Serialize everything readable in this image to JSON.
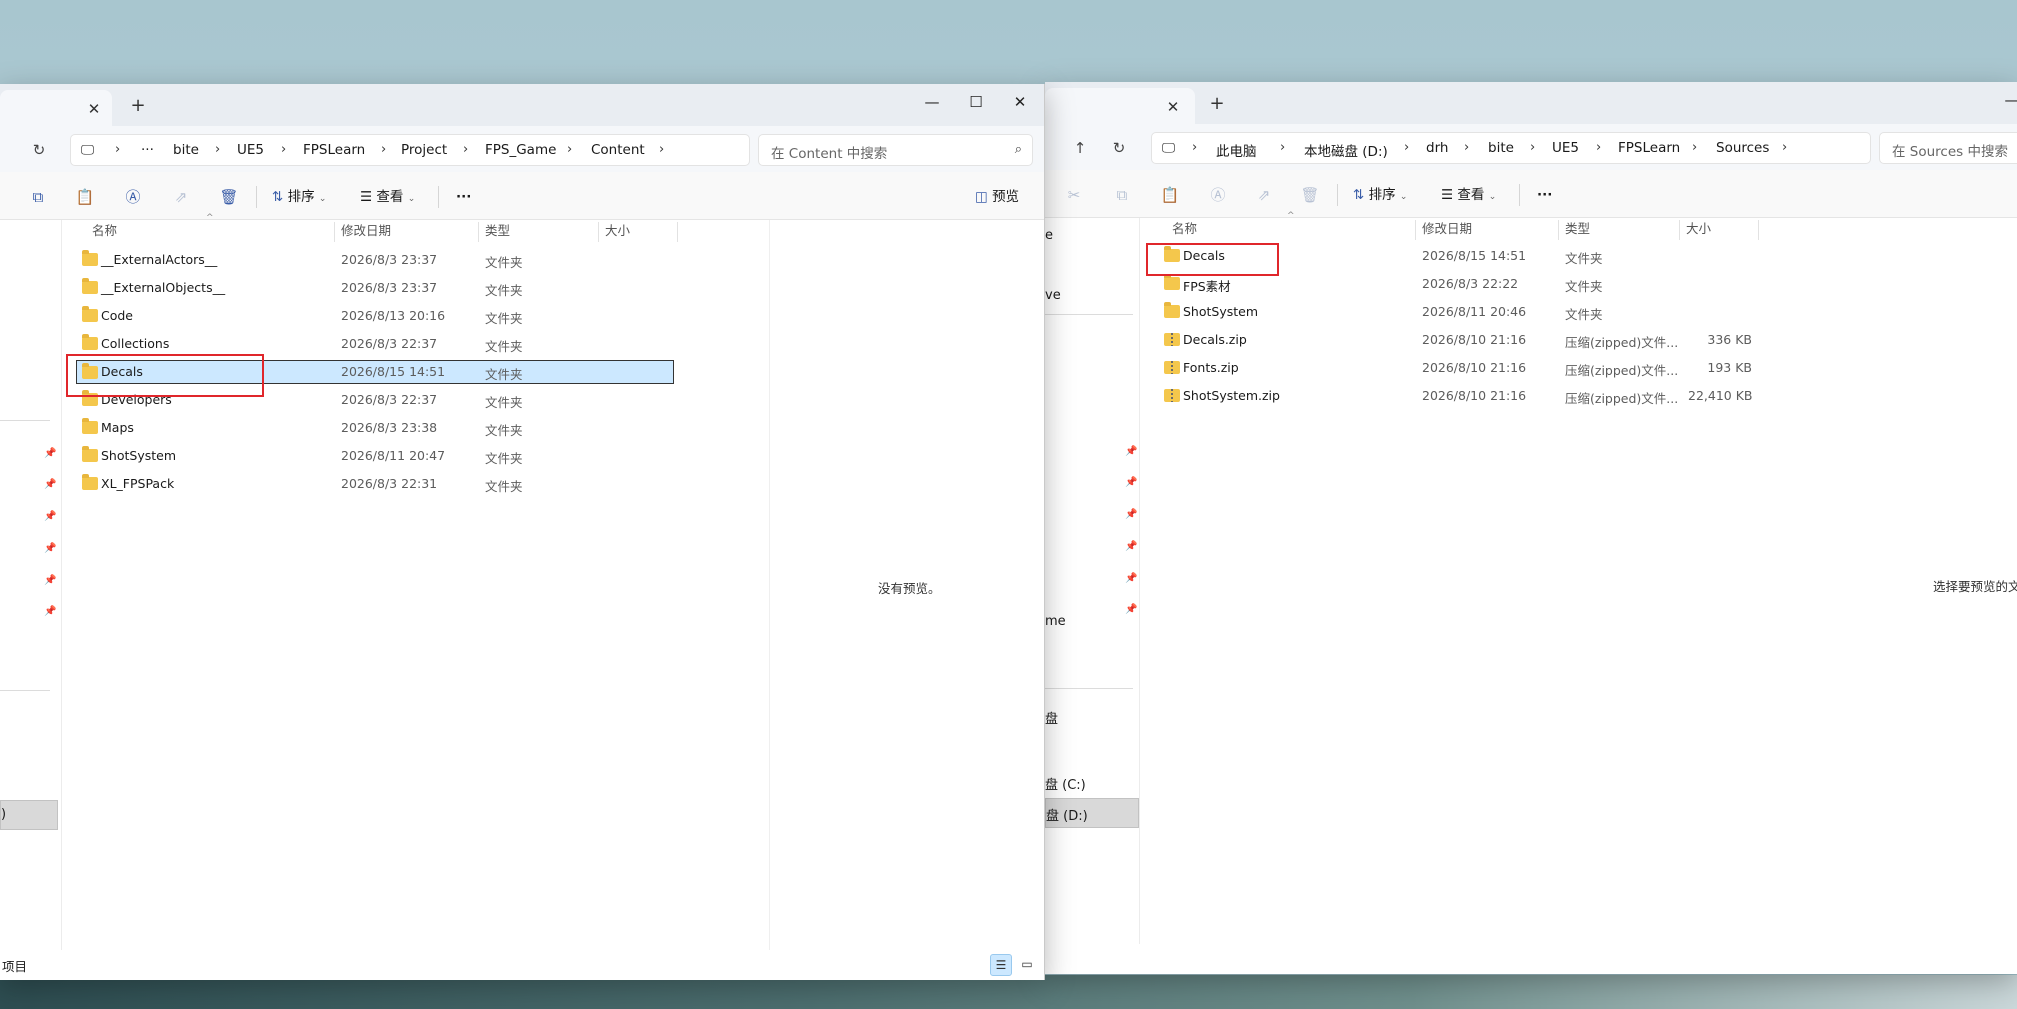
{
  "left_window": {
    "breadcrumb": [
      "···",
      "bite",
      "UE5",
      "FPSLearn",
      "Project",
      "FPS_Game",
      "Content"
    ],
    "search_placeholder": "在 Content 中搜索",
    "toolbar": {
      "sort_label": "排序",
      "view_label": "查看",
      "more_label": "···",
      "preview_label": "预览"
    },
    "columns": {
      "name": "名称",
      "date": "修改日期",
      "type": "类型",
      "size": "大小"
    },
    "rows": [
      {
        "name": "__ExternalActors__",
        "date": "2026/8/3 23:37",
        "type": "文件夹",
        "size": ""
      },
      {
        "name": "__ExternalObjects__",
        "date": "2026/8/3 23:37",
        "type": "文件夹",
        "size": ""
      },
      {
        "name": "Code",
        "date": "2026/8/13 20:16",
        "type": "文件夹",
        "size": ""
      },
      {
        "name": "Collections",
        "date": "2026/8/3 22:37",
        "type": "文件夹",
        "size": ""
      },
      {
        "name": "Decals",
        "date": "2026/8/15 14:51",
        "type": "文件夹",
        "size": ""
      },
      {
        "name": "Developers",
        "date": "2026/8/3 22:37",
        "type": "文件夹",
        "size": ""
      },
      {
        "name": "Maps",
        "date": "2026/8/3 23:38",
        "type": "文件夹",
        "size": ""
      },
      {
        "name": "ShotSystem",
        "date": "2026/8/11 20:47",
        "type": "文件夹",
        "size": ""
      },
      {
        "name": "XL_FPSPack",
        "date": "2026/8/3 22:31",
        "type": "文件夹",
        "size": ""
      }
    ],
    "selected_row": "Decals",
    "nav_items": [
      ")"
    ],
    "preview_text": "没有预览。",
    "status_text": "项目"
  },
  "right_window": {
    "breadcrumb": [
      "此电脑",
      "本地磁盘 (D:)",
      "drh",
      "bite",
      "UE5",
      "FPSLearn",
      "Sources"
    ],
    "search_placeholder": "在 Sources 中搜索",
    "toolbar": {
      "sort_label": "排序",
      "view_label": "查看",
      "more_label": "···"
    },
    "columns": {
      "name": "名称",
      "date": "修改日期",
      "type": "类型",
      "size": "大小"
    },
    "rows": [
      {
        "name": "Decals",
        "date": "2026/8/15 14:51",
        "type": "文件夹",
        "size": "",
        "kind": "folder"
      },
      {
        "name": "FPS素材",
        "date": "2026/8/3 22:22",
        "type": "文件夹",
        "size": "",
        "kind": "folder"
      },
      {
        "name": "ShotSystem",
        "date": "2026/8/11 20:46",
        "type": "文件夹",
        "size": "",
        "kind": "folder"
      },
      {
        "name": "Decals.zip",
        "date": "2026/8/10 21:16",
        "type": "压缩(zipped)文件...",
        "size": "336 KB",
        "kind": "zip"
      },
      {
        "name": "Fonts.zip",
        "date": "2026/8/10 21:16",
        "type": "压缩(zipped)文件...",
        "size": "193 KB",
        "kind": "zip"
      },
      {
        "name": "ShotSystem.zip",
        "date": "2026/8/10 21:16",
        "type": "压缩(zipped)文件...",
        "size": "22,410 KB",
        "kind": "zip"
      }
    ],
    "nav_items": [
      "e",
      "ve",
      "me",
      "盘",
      "盘 (C:)",
      "盘 (D:)"
    ],
    "preview_text": "选择要预览的文"
  },
  "icons": [
    "close-icon",
    "plus-icon",
    "minimize-icon",
    "maximize-icon",
    "refresh-icon",
    "up-arrow-icon",
    "monitor-icon",
    "chevron-right-icon",
    "search-icon",
    "copy-icon",
    "paste-icon",
    "rename-icon",
    "share-icon",
    "delete-icon",
    "cut-icon",
    "sort-icon",
    "view-icon",
    "more-icon",
    "preview-pane-icon",
    "pin-icon",
    "folder-icon",
    "zip-folder-icon",
    "details-view-icon",
    "tiles-view-icon"
  ],
  "colors": {
    "selection": "#cce8ff",
    "highlight_box": "#e0262b",
    "folder": "#f4c74c",
    "accent": "#3a5da8"
  }
}
